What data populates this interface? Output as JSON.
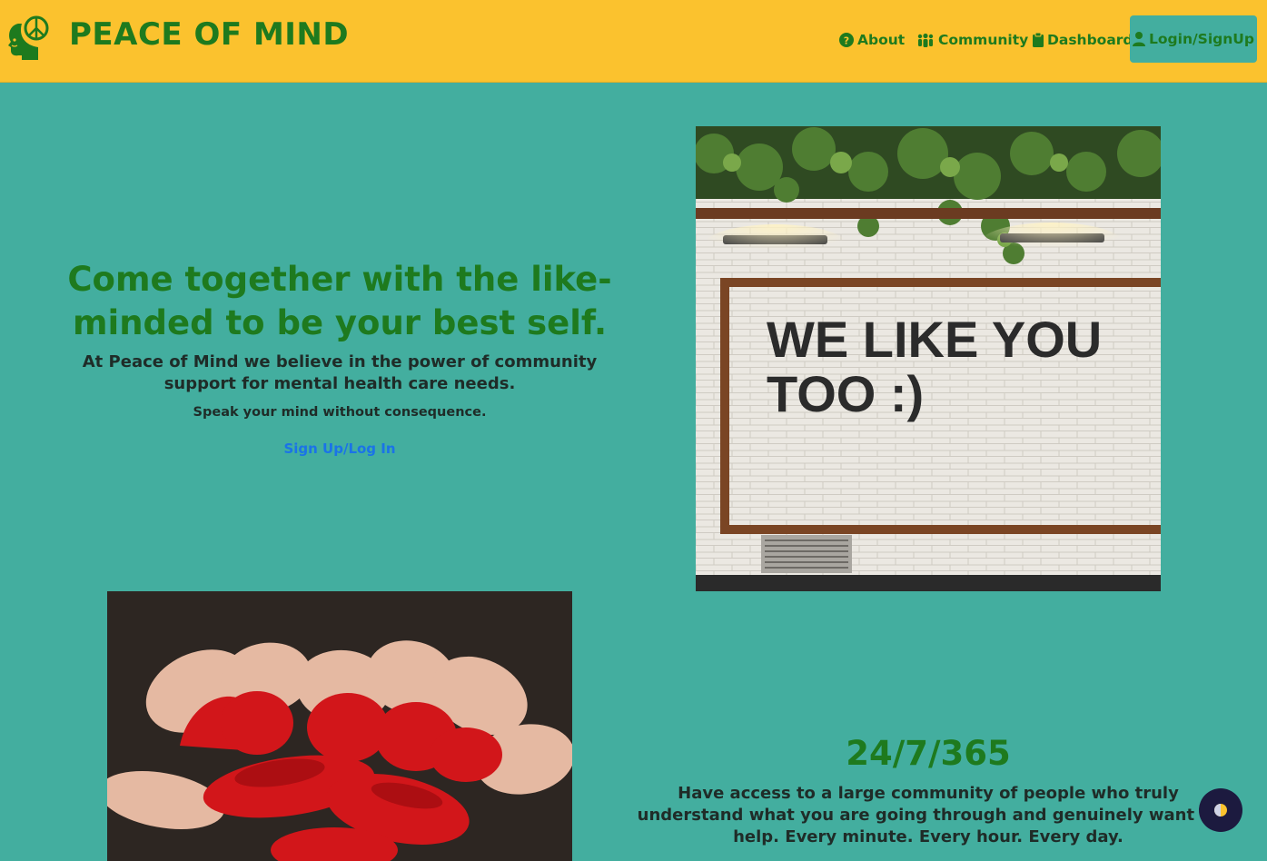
{
  "brand": {
    "name": "PEACE OF MIND",
    "logo_icon": "head-peace-icon"
  },
  "nav": {
    "about": "About",
    "community": "Community",
    "dashboard": "Dashboard",
    "login": "Login/SignUp"
  },
  "hero": {
    "title": "Come together with the like-minded to be your best self.",
    "subtitle": "At Peace of Mind we believe in the power of community support for mental health care needs.",
    "tagline": "Speak your mind without consequence.",
    "cta": "Sign Up/Log In"
  },
  "wall_image": {
    "sign_text_line1": "WE LIKE YOU",
    "sign_text_line2": "TOO :)"
  },
  "stat": {
    "title": "24/7/365",
    "text": "Have access to a large community of people who truly understand what you are going through and genuinely want to help. Every minute. Every hour. Every day."
  },
  "colors": {
    "navbar": "#fbc22e",
    "background": "#43ae9f",
    "brand_green": "#1e7a1e",
    "link_blue": "#1a73e8",
    "toggle": "#1c1a3f"
  }
}
